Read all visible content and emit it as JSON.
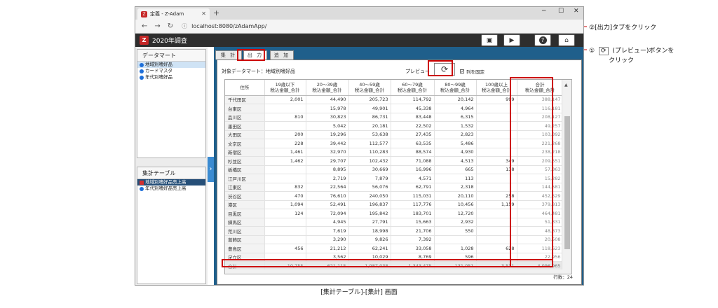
{
  "browser": {
    "tab_title": "定義 - Z-Adam",
    "new_tab": "+",
    "minimize": "─",
    "maximize": "☐",
    "close": "✕",
    "url": "localhost:8080/zAdamApp/"
  },
  "app": {
    "title": "2020年調査",
    "logo_glyph": "Z"
  },
  "sidebar": {
    "datamart_title": "データマート",
    "datamart_items": [
      "地域別嗜好品",
      "カードマスタ",
      "年代別嗜好品"
    ],
    "aggtable_title": "集計テーブル",
    "aggtable_items": [
      "地域別嗜好品売上高",
      "年代別嗜好品売上高"
    ]
  },
  "tabs": [
    "集 計",
    "出 力",
    "追 加"
  ],
  "panel": {
    "target_label": "対象データマート：地域別嗜好品",
    "preview_label": "プレビュー",
    "fix_columns_label": "列を固定",
    "row_count": "行数：24"
  },
  "table": {
    "columns": [
      "住所",
      "19歳以下\n税込金額_合計",
      "20～39歳\n税込金額_合計",
      "40～59歳\n税込金額_合計",
      "60～79歳\n税込金額_合計",
      "80～99歳\n税込金額_合計",
      "100歳以上\n税込金額_合計",
      "合計\n税込金額_合計"
    ],
    "rows": [
      [
        "千代田区",
        "2,001",
        "44,490",
        "205,723",
        "114,792",
        "20,142",
        "999",
        "388,147"
      ],
      [
        "台東区",
        "",
        "15,978",
        "49,901",
        "45,338",
        "4,964",
        "",
        "116,181"
      ],
      [
        "品川区",
        "810",
        "30,823",
        "86,731",
        "83,448",
        "6,315",
        "",
        "208,127"
      ],
      [
        "墨田区",
        "",
        "5,042",
        "20,181",
        "22,502",
        "1,532",
        "",
        "49,257"
      ],
      [
        "大田区",
        "200",
        "19,296",
        "53,638",
        "27,435",
        "2,823",
        "",
        "103,392"
      ],
      [
        "文京区",
        "228",
        "39,442",
        "112,577",
        "63,535",
        "5,486",
        "",
        "221,268"
      ],
      [
        "新宿区",
        "1,461",
        "32,970",
        "110,283",
        "88,574",
        "4,930",
        "",
        "238,218"
      ],
      [
        "杉並区",
        "1,462",
        "29,707",
        "102,432",
        "71,088",
        "4,513",
        "349",
        "209,551"
      ],
      [
        "板橋区",
        "",
        "8,895",
        "30,669",
        "16,996",
        "665",
        "138",
        "57,363"
      ],
      [
        "江戸川区",
        "",
        "2,719",
        "7,879",
        "4,571",
        "113",
        "",
        "15,282"
      ],
      [
        "江東区",
        "832",
        "22,564",
        "56,076",
        "62,791",
        "2,318",
        "",
        "144,581"
      ],
      [
        "渋谷区",
        "470",
        "76,610",
        "240,050",
        "115,031",
        "20,110",
        "258",
        "452,529"
      ],
      [
        "港区",
        "1,094",
        "52,491",
        "196,837",
        "117,776",
        "10,456",
        "1,159",
        "379,813"
      ],
      [
        "目黒区",
        "124",
        "72,094",
        "195,842",
        "183,701",
        "12,720",
        "",
        "464,481"
      ],
      [
        "練馬区",
        "",
        "4,945",
        "27,791",
        "15,663",
        "2,932",
        "",
        "51,331"
      ],
      [
        "荒川区",
        "",
        "7,619",
        "18,998",
        "21,706",
        "550",
        "",
        "48,873"
      ],
      [
        "葛飾区",
        "",
        "3,290",
        "9,826",
        "7,392",
        "",
        "",
        "20,508"
      ],
      [
        "豊島区",
        "456",
        "21,212",
        "62,241",
        "33,058",
        "1,028",
        "628",
        "118,623"
      ],
      [
        "足立区",
        "",
        "3,562",
        "10,029",
        "8,769",
        "596",
        "",
        "22,956"
      ]
    ],
    "total": [
      "合計",
      "10,755",
      "621,115",
      "1,987,038",
      "1,343,475",
      "131,051",
      "3,531",
      "4,096,965"
    ]
  },
  "callouts": {
    "step2": "②[出力]タブをクリック",
    "step1_line1": "①",
    "step1_icon": "⟳",
    "step1_text": "(プレビュー)ボタンを",
    "step1_line2": "クリック"
  },
  "caption": "[集計テーブル]-[集計] 画面",
  "colors": {
    "accent_red": "#cc0000",
    "app_bar": "#2e2e2e",
    "main_bg": "#1f5f8b",
    "selected_item": "#264f78"
  }
}
